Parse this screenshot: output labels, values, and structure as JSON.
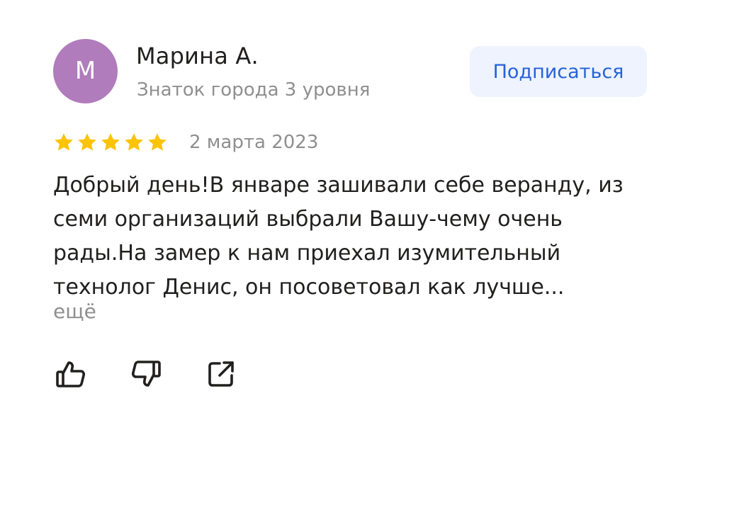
{
  "review": {
    "author": {
      "avatar_letter": "М",
      "avatar_color": "#b07cbc",
      "name": "Марина А.",
      "level": "Знаток города 3 уровня"
    },
    "subscribe_label": "Подписаться",
    "rating": 5,
    "date": "2 марта 2023",
    "text": "Добрый день!В январе зашивали себе веранду, из семи организаций выбрали Вашу-чему очень рады.На замер к нам приехал изумительный технолог Денис, он посоветовал как лучше...",
    "more_label": "ещё",
    "actions": {
      "like_icon": "thumb-up-icon",
      "dislike_icon": "thumb-down-icon",
      "share_icon": "share-icon"
    },
    "colors": {
      "star": "#fcc307",
      "accent": "#2762d9",
      "secondary_text": "#8f8f8f"
    }
  }
}
